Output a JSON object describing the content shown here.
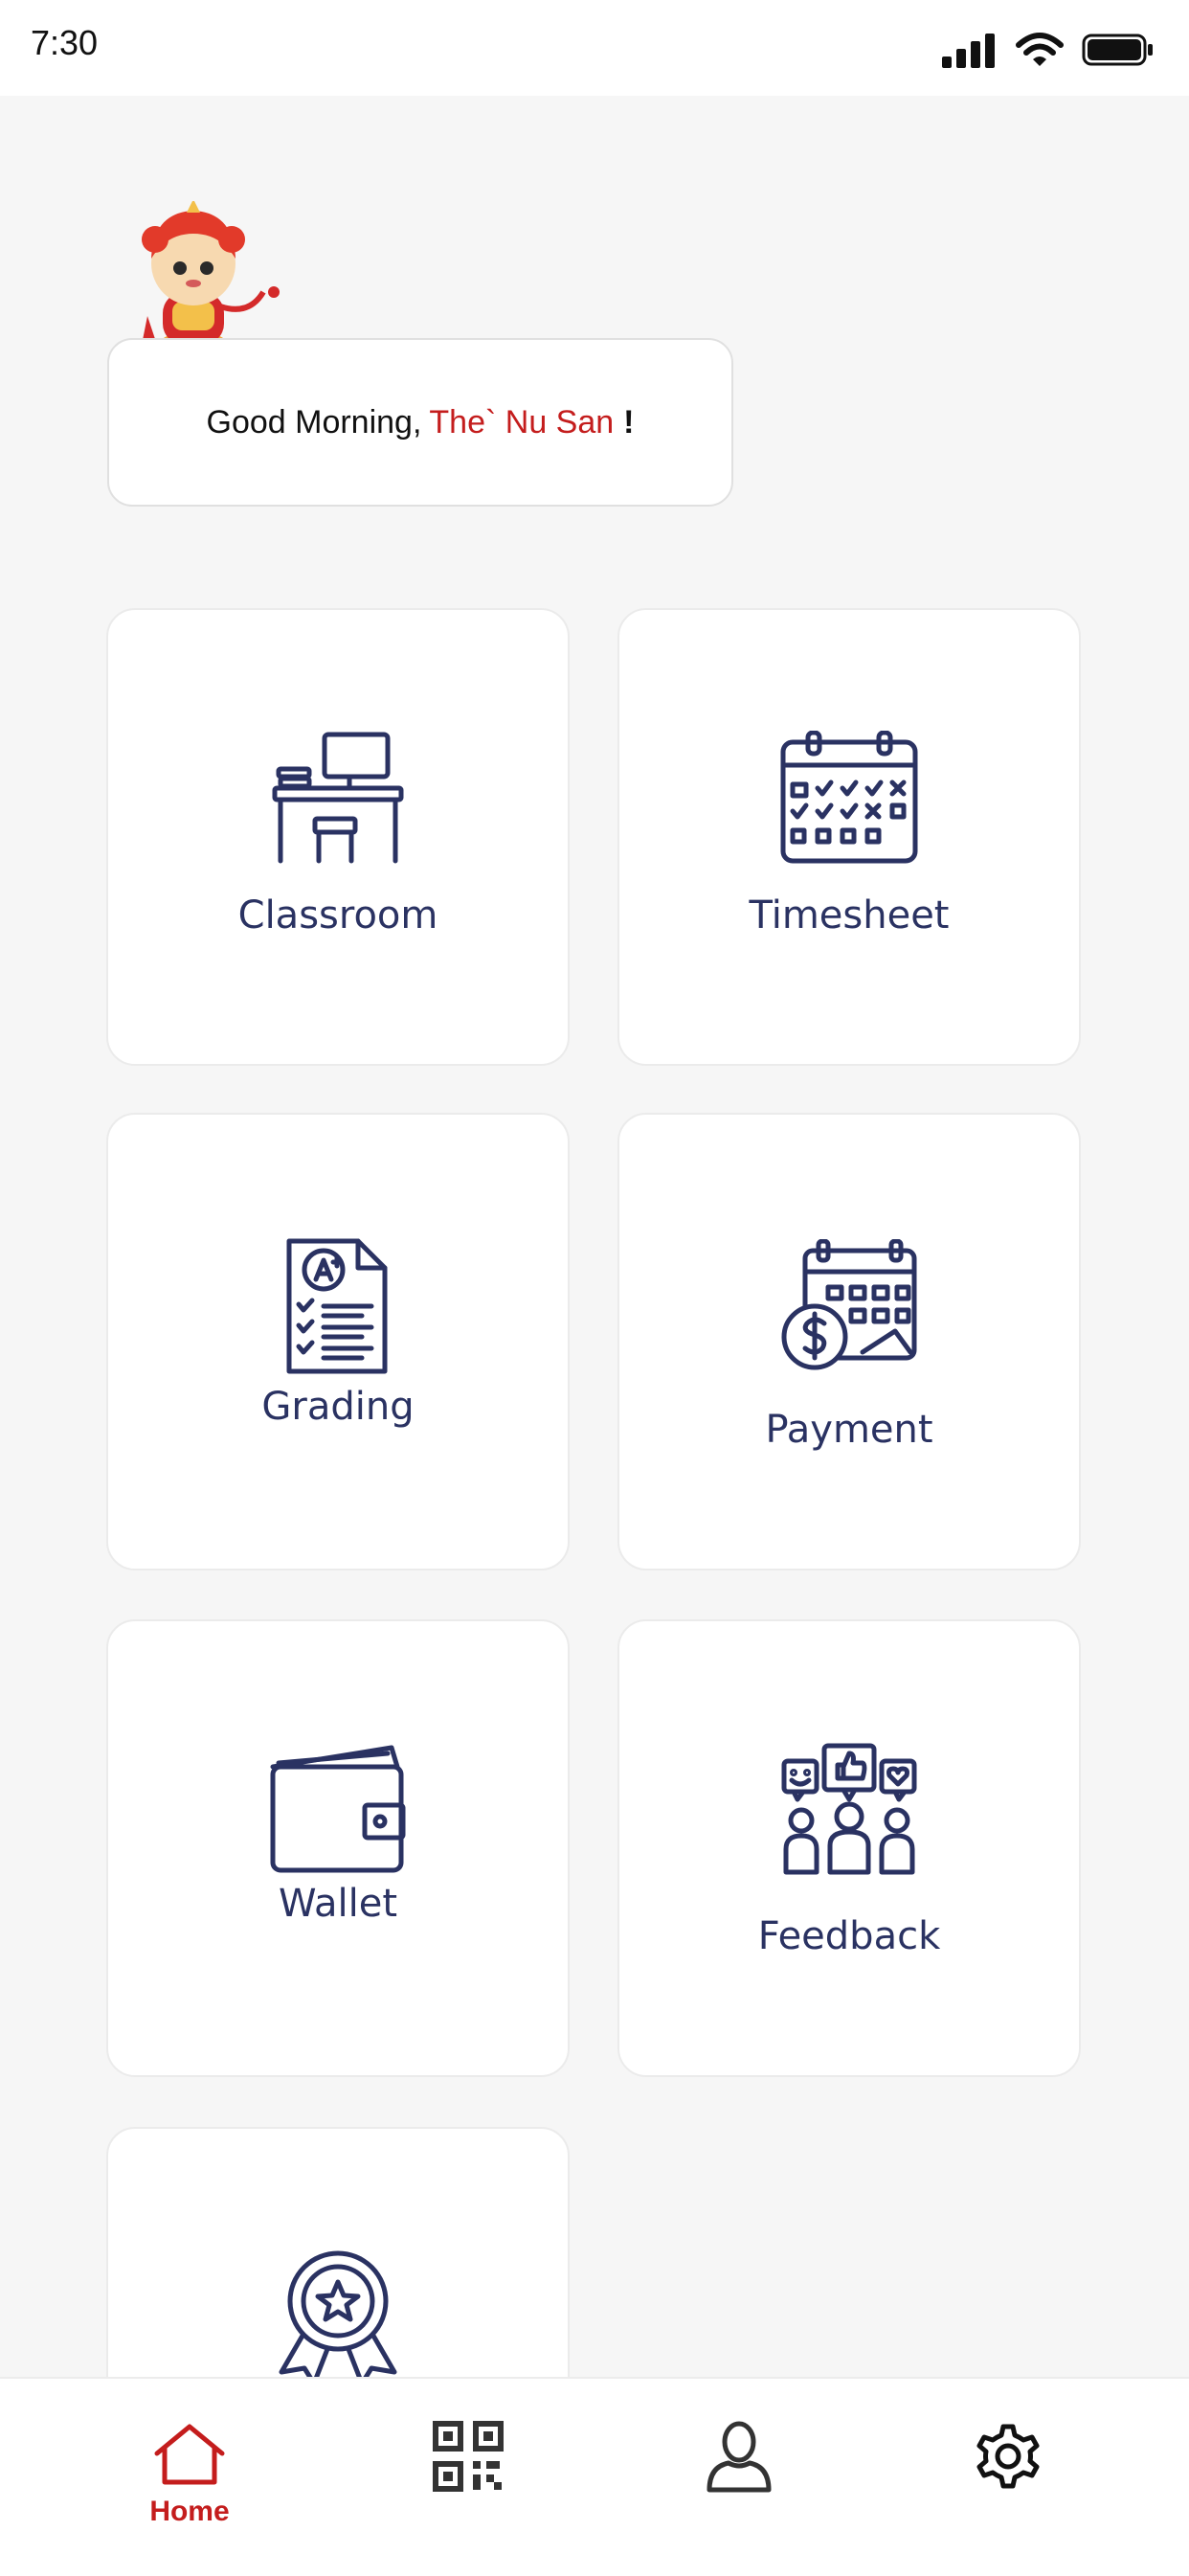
{
  "status_bar": {
    "time": "7:30"
  },
  "greeting": {
    "prefix": "Good Morning,",
    "name": "The` Nu San",
    "suffix": "!"
  },
  "tiles": [
    {
      "label": "Classroom",
      "icon": "desk-icon"
    },
    {
      "label": "Timesheet",
      "icon": "calendar-icon"
    },
    {
      "label": "Grading",
      "icon": "grade-sheet-icon"
    },
    {
      "label": "Payment",
      "icon": "payment-calendar-icon"
    },
    {
      "label": "Wallet",
      "icon": "wallet-icon"
    },
    {
      "label": "Feedback",
      "icon": "feedback-icon"
    },
    {
      "label": "",
      "icon": "award-badge-icon"
    }
  ],
  "tabbar": {
    "home_label": "Home",
    "items": [
      "home-icon",
      "qr-code-icon",
      "profile-icon",
      "settings-icon"
    ]
  },
  "colors": {
    "accent": "#c41d1d",
    "icon_navy": "#2a3262",
    "background": "#f6f6f6"
  }
}
